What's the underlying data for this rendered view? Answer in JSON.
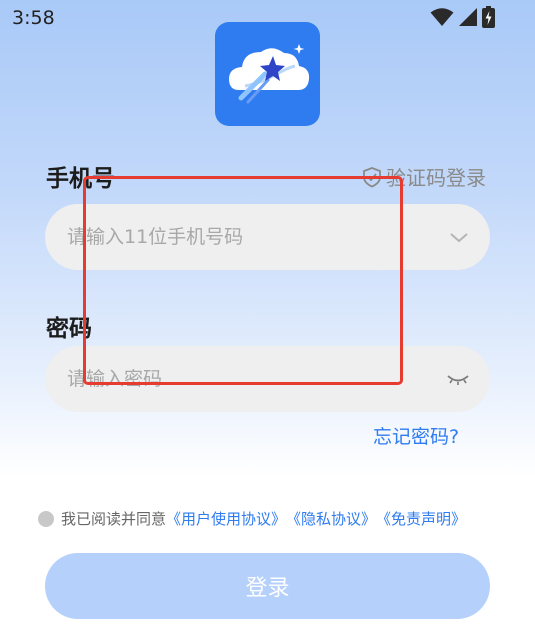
{
  "status_bar": {
    "time": "3:58",
    "icons": [
      "wifi-icon",
      "cellular-icon",
      "battery-charging-icon"
    ]
  },
  "app": {
    "logo_icon": "cloud-star-logo"
  },
  "form": {
    "phone_label": "手机号",
    "code_login_label": "验证码登录",
    "phone_placeholder": "请输入11位手机号码",
    "password_label": "密码",
    "password_placeholder": "请输入密码",
    "forgot_password": "忘记密码?"
  },
  "agreement": {
    "prefix": "我已阅读并同意",
    "user_agreement": "《用户使用协议》",
    "privacy_agreement": "《隐私协议》",
    "disclaimer": "《免责声明》"
  },
  "login_button": {
    "label": "登录"
  },
  "colors": {
    "accent": "#2f7bf0",
    "button_disabled": "#b4d0fb",
    "annotation": "#e53b30"
  }
}
